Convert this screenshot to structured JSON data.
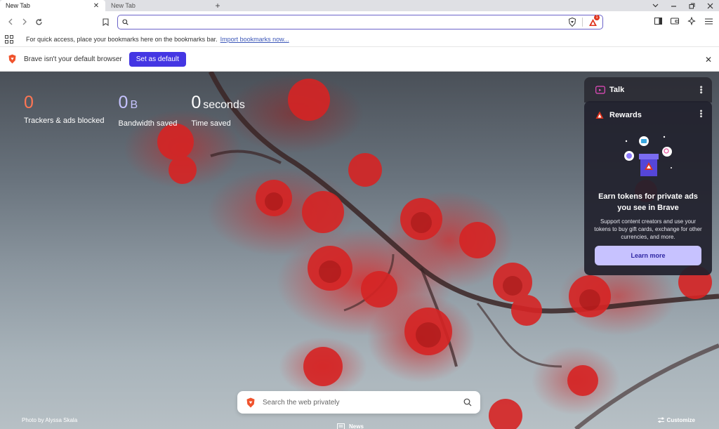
{
  "tabs": [
    {
      "title": "New Tab",
      "active": true
    },
    {
      "title": "New Tab",
      "active": false
    }
  ],
  "new_tab_symbol": "+",
  "window_controls": [
    "chevron-down-icon",
    "minimize-icon",
    "restore-icon",
    "close-icon"
  ],
  "toolbar": {
    "omnibox_value": "",
    "rewards_badge": "1"
  },
  "bookmarks_bar": {
    "text": "For quick access, place your bookmarks here on the bookmarks bar.",
    "link": "Import bookmarks now..."
  },
  "infobar": {
    "text": "Brave isn't your default browser",
    "button": "Set as default"
  },
  "stats": {
    "trackers_value": "0",
    "trackers_label": "Trackers & ads blocked",
    "bandwidth_value": "0",
    "bandwidth_unit": "B",
    "bandwidth_label": "Bandwidth saved",
    "time_value": "0",
    "time_unit": "seconds",
    "time_label": "Time saved"
  },
  "widgets": {
    "talk_title": "Talk",
    "rewards_title": "Rewards",
    "rewards_heading": "Earn tokens for private ads you see in Brave",
    "rewards_desc": "Support content creators and use your tokens to buy gift cards, exchange for other currencies, and more.",
    "rewards_button": "Learn more"
  },
  "search": {
    "placeholder": "Search the web privately"
  },
  "photo_credit": "Photo by Alyssa Skala",
  "news_label": "News",
  "customize_label": "Customize",
  "colors": {
    "accent": "#4436e3",
    "trackers": "#ff7654",
    "bandwidth": "#c6c3ff",
    "brave_orange": "#f0532d"
  }
}
